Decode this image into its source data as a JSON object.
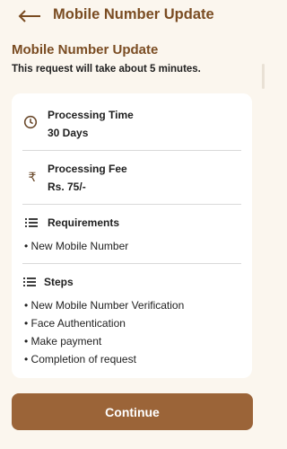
{
  "header": {
    "back_icon": "arrow-left-icon",
    "title": "Mobile Number Update"
  },
  "section": {
    "title": "Mobile Number Update",
    "subtitle": "This request will take about 5 minutes."
  },
  "card": {
    "processing_time": {
      "icon": "clock-icon",
      "label": "Processing Time",
      "value": "30 Days"
    },
    "processing_fee": {
      "icon": "rupee-icon",
      "symbol": "₹",
      "label": "Processing Fee",
      "value": "Rs. 75/-"
    },
    "requirements": {
      "icon": "list-icon",
      "label": "Requirements",
      "items": [
        "• New Mobile Number"
      ]
    },
    "steps": {
      "icon": "list-icon",
      "label": "Steps",
      "items": [
        "• New Mobile Number Verification",
        "• Face Authentication",
        "• Make payment",
        "• Completion of request"
      ]
    }
  },
  "actions": {
    "continue_label": "Continue"
  },
  "colors": {
    "background": "#fbf6ee",
    "brand_brown": "#7a4c22",
    "button": "#9b6438",
    "card": "#ffffff"
  }
}
